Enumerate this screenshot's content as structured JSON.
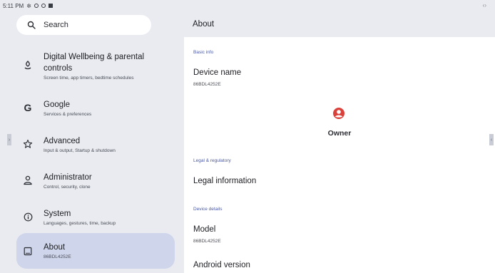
{
  "status_bar": {
    "time": "5:11 PM",
    "icons": [
      "gear-icon",
      "shield-icon",
      "circle-icon",
      "square-icon"
    ],
    "right_glyph": "‹›"
  },
  "search": {
    "label": "Search",
    "icon": "search-icon"
  },
  "menu": [
    {
      "title": "Digital Wellbeing & parental",
      "title2": "controls",
      "subtitle": "Screen time, app timers, bedtime schedules",
      "icon": "wellbeing-icon"
    },
    {
      "title": "Google",
      "subtitle": "Services & preferences",
      "icon": "google-icon"
    },
    {
      "title": "Advanced",
      "subtitle": "Input & output, Startup & shutdown",
      "icon": "star-icon"
    },
    {
      "title": "Administrator",
      "subtitle": "Control, security, clone",
      "icon": "person-icon"
    },
    {
      "title": "System",
      "subtitle": "Languages, gestures, time, backup",
      "icon": "info-icon"
    },
    {
      "title": "About",
      "subtitle": "86BDL4252E",
      "icon": "tablet-icon",
      "selected": true
    }
  ],
  "detail": {
    "title": "About",
    "sections": {
      "basic_info": "Basic info",
      "legal": "Legal & regulatory",
      "device_details": "Device details"
    },
    "device_name": {
      "title": "Device name",
      "value": "86BDL4252E"
    },
    "owner": {
      "label": "Owner",
      "icon": "account-circle-icon"
    },
    "legal_information": "Legal information",
    "model": {
      "title": "Model",
      "value": "86BDL4252E"
    },
    "android_version": "Android version"
  },
  "colors": {
    "background": "#e9ebf1",
    "selected": "#cfd5ea",
    "accent": "#4a5aa8",
    "owner_icon": "#d9413a"
  }
}
